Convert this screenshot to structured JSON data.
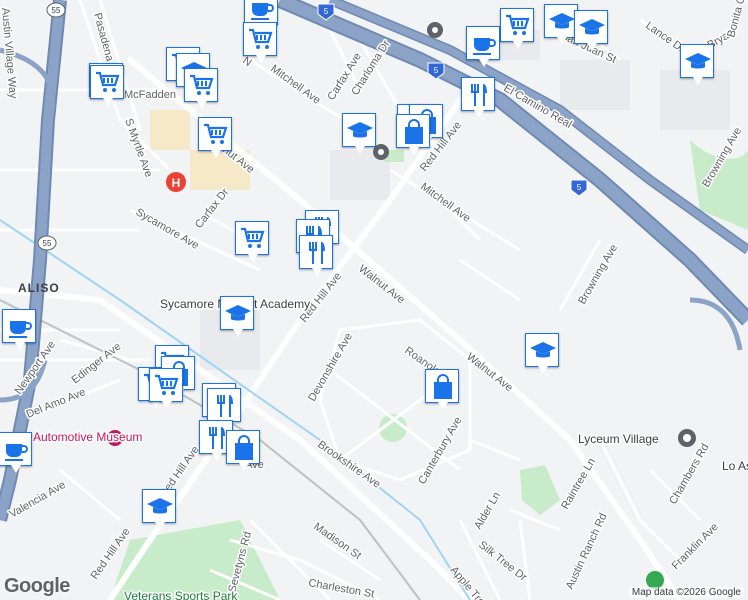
{
  "map": {
    "city_label": "ALISO",
    "attribution": "Map data ©2026 Google",
    "logo_text": "Google",
    "highway_shields": [
      "5",
      "5",
      "5",
      "55",
      "55"
    ],
    "colors": {
      "background": "#f1f3f4",
      "minor_road": "#ffffff",
      "major_road": "#ffffff",
      "highway": "#8ba3c7",
      "highway_edge": "#6f89b3",
      "park": "#c8ebc9",
      "water_line": "#9fd4f5",
      "rail": "#bdc1c6",
      "block": "#e8eaed",
      "pin_border": "#1a73e8",
      "pin_fill": "#ffffff",
      "poi_icon": "#1a73e8",
      "hospital": "#ea4335"
    }
  },
  "streets": [
    "Walnut Ave",
    "Walnut Ave",
    "Red Hill Ave",
    "Red Hill Ave",
    "Red Hill Ave",
    "Red Hill Ave",
    "El Camino Real",
    "Mitchell Ave",
    "Mitchell Ave",
    "Sycamore Ave",
    "Carfax Dr",
    "Carfax Ave",
    "Charloma Dr",
    "Devonshire Ave",
    "Brookshire Ave",
    "Roanoke",
    "Canterbury Ave",
    "Browning Ave",
    "Browning Ave",
    "Alder Ln",
    "Raintree Ln",
    "Chambers Rd",
    "Franklin Ave",
    "Silk Tree Dr",
    "Apple Tree",
    "Austin Ranch Rd",
    "Madison St",
    "Charleston St",
    "Sevetyns Rd",
    "Valencia Ave",
    "Del Amo Ave",
    "Edinger Ave",
    "Newport Ave",
    "S Myrtle Ave",
    "Pasadena",
    "Austin Village Way",
    "Lance Dr",
    "San Juan St",
    "Bryan",
    "Bonita Canyon",
    "nut Ave",
    "N",
    "Ave"
  ],
  "places": [
    {
      "name": "Sycamore Magnet Academy",
      "kind": "school"
    },
    {
      "name": "Automotive Museum",
      "kind": "museum"
    },
    {
      "name": "Lyceum Village",
      "kind": "landmark"
    },
    {
      "name": "Lo Asyl",
      "kind": "landmark"
    },
    {
      "name": "McFadden",
      "kind": "street"
    },
    {
      "name": "Veterans Sports Park",
      "kind": "park"
    }
  ],
  "pins": [
    {
      "icon": "cup-icon"
    },
    {
      "icon": "cart-icon"
    },
    {
      "icon": "graduation-cap-icon"
    },
    {
      "icon": "graduation-cap-icon"
    },
    {
      "icon": "cart-icon"
    },
    {
      "icon": "cup-icon"
    },
    {
      "icon": "cart-icon"
    },
    {
      "icon": "graduation-cap-icon"
    },
    {
      "icon": "cart-icon"
    },
    {
      "icon": "cart-icon"
    },
    {
      "icon": "cart-icon"
    },
    {
      "icon": "cart-icon"
    },
    {
      "icon": "bag-icon"
    },
    {
      "icon": "cutlery-icon"
    },
    {
      "icon": "bag-icon"
    },
    {
      "icon": "bag-icon"
    },
    {
      "icon": "graduation-cap-icon"
    },
    {
      "icon": "cart-icon"
    },
    {
      "icon": "cutlery-icon"
    },
    {
      "icon": "cutlery-icon"
    },
    {
      "icon": "cutlery-icon"
    },
    {
      "icon": "graduation-cap-icon"
    },
    {
      "icon": "graduation-cap-icon"
    },
    {
      "icon": "cup-icon"
    },
    {
      "icon": "cart-icon"
    },
    {
      "icon": "cart-icon"
    },
    {
      "icon": "bag-icon"
    },
    {
      "icon": "cart-icon"
    },
    {
      "icon": "cutlery-icon"
    },
    {
      "icon": "cutlery-icon"
    },
    {
      "icon": "cutlery-icon"
    },
    {
      "icon": "bag-icon"
    },
    {
      "icon": "cup-icon"
    },
    {
      "icon": "graduation-cap-icon"
    },
    {
      "icon": "graduation-cap-icon"
    },
    {
      "icon": "bag-icon"
    }
  ]
}
